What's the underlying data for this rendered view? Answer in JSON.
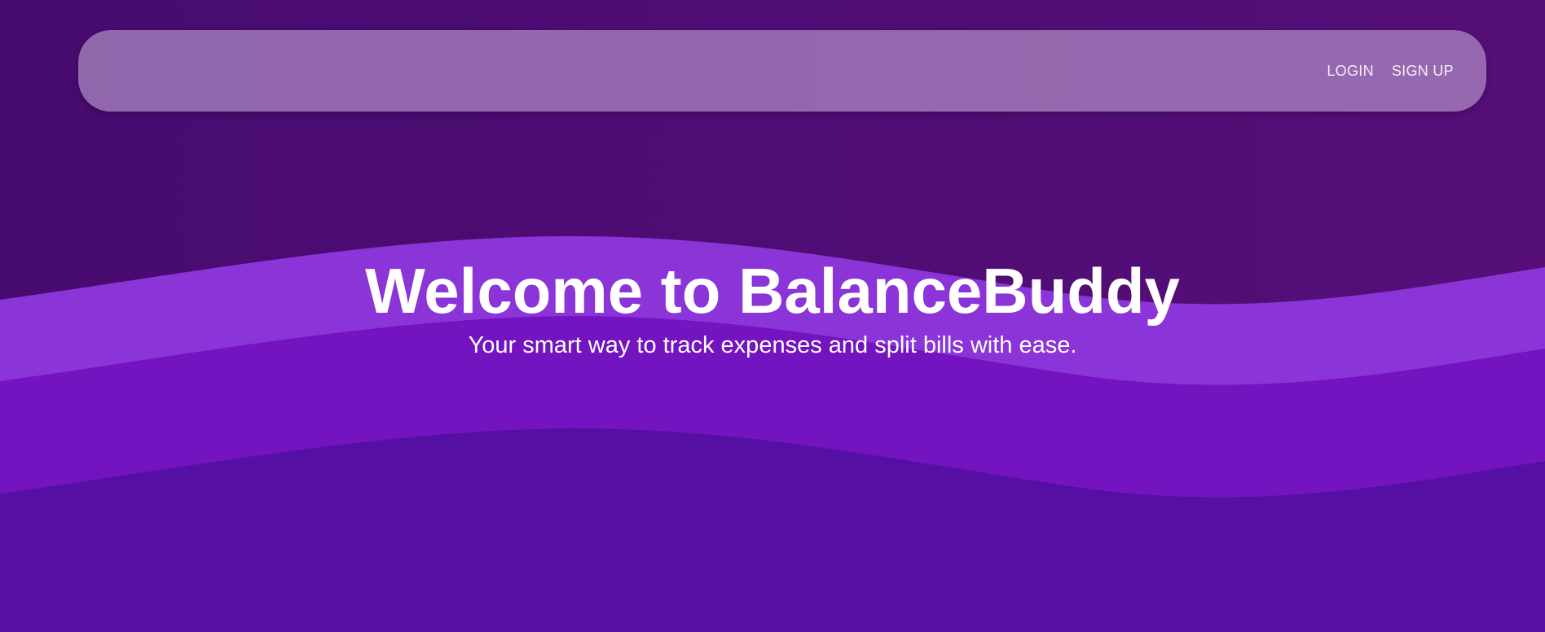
{
  "nav": {
    "login": "LOGIN",
    "signup": "SIGN UP"
  },
  "hero": {
    "title": "Welcome to BalanceBuddy",
    "subtitle": "Your smart way to track expenses and split bills with ease."
  },
  "colors": {
    "background": "#4e0d74",
    "wave_light": "#8b34d8",
    "wave_mid": "#7414c0",
    "wave_bottom": "#560fa3",
    "navbar": "rgba(190,160,210,0.62)",
    "text": "#ffffff"
  }
}
